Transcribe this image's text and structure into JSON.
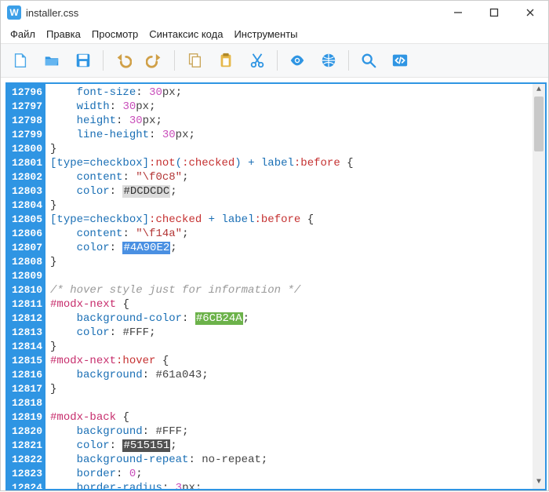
{
  "window": {
    "title": "installer.css",
    "app_initial": "W"
  },
  "menu": {
    "file": "Файл",
    "edit": "Правка",
    "view": "Просмотр",
    "syntax": "Синтаксис кода",
    "tools": "Инструменты"
  },
  "toolbar_icons": {
    "new": "new-file-icon",
    "open": "open-folder-icon",
    "save": "save-icon",
    "undo": "undo-icon",
    "redo": "redo-icon",
    "copy": "copy-icon",
    "paste": "paste-icon",
    "cut": "cut-icon",
    "eye": "eye-icon",
    "nav": "globe-icon",
    "find": "search-icon",
    "code": "code-icon"
  },
  "lines": [
    {
      "n": 12796,
      "indent": 2,
      "type": "prop",
      "prop": "font-size",
      "val": "30",
      "unit": "px"
    },
    {
      "n": 12797,
      "indent": 2,
      "type": "prop",
      "prop": "width",
      "val": "30",
      "unit": "px"
    },
    {
      "n": 12798,
      "indent": 2,
      "type": "prop",
      "prop": "height",
      "val": "30",
      "unit": "px"
    },
    {
      "n": 12799,
      "indent": 2,
      "type": "prop",
      "prop": "line-height",
      "val": "30",
      "unit": "px"
    },
    {
      "n": 12800,
      "indent": 0,
      "type": "close"
    },
    {
      "n": 12801,
      "indent": 0,
      "type": "raw",
      "html": "<span class='tk-sel'>[type=checkbox]</span><span class='tk-pseudo'>:not</span><span class='tk-sel'>(</span><span class='tk-pseudo'>:checked</span><span class='tk-sel'>) + label</span><span class='tk-pseudo'>:before</span> <span class='tk-brace'>{</span>"
    },
    {
      "n": 12802,
      "indent": 2,
      "type": "raw",
      "html": "<span class='tk-prop'>content</span><span class='tk-punct'>: </span><span class='tk-str'>\"\\f0c8\"</span><span class='tk-punct'>;</span>"
    },
    {
      "n": 12803,
      "indent": 2,
      "type": "raw",
      "html": "<span class='tk-prop'>color</span><span class='tk-punct'>: </span><span class='hl-grey'>#DCDCDC</span><span class='tk-punct'>;</span>"
    },
    {
      "n": 12804,
      "indent": 0,
      "type": "close"
    },
    {
      "n": 12805,
      "indent": 0,
      "type": "raw",
      "html": "<span class='tk-sel'>[type=checkbox]</span><span class='tk-pseudo'>:checked</span><span class='tk-sel'> + label</span><span class='tk-pseudo'>:before</span> <span class='tk-brace'>{</span>"
    },
    {
      "n": 12806,
      "indent": 2,
      "type": "raw",
      "html": "<span class='tk-prop'>content</span><span class='tk-punct'>: </span><span class='tk-str'>\"\\f14a\"</span><span class='tk-punct'>;</span>"
    },
    {
      "n": 12807,
      "indent": 2,
      "type": "raw",
      "html": "<span class='tk-prop'>color</span><span class='tk-punct'>: </span><span class='hl-blue'>#4A90E2</span><span class='tk-punct'>;</span>"
    },
    {
      "n": 12808,
      "indent": 0,
      "type": "close"
    },
    {
      "n": 12809,
      "indent": 0,
      "type": "blank"
    },
    {
      "n": 12810,
      "indent": 0,
      "type": "raw",
      "html": "<span class='tk-comment'>/* hover style just for information */</span>"
    },
    {
      "n": 12811,
      "indent": 0,
      "type": "raw",
      "html": "<span class='tk-id'>#modx-next</span> <span class='tk-brace'>{</span>"
    },
    {
      "n": 12812,
      "indent": 2,
      "type": "raw",
      "html": "<span class='tk-prop'>background-color</span><span class='tk-punct'>: </span><span class='hl-green'>#6CB24A</span><span class='tk-punct'>;</span>"
    },
    {
      "n": 12813,
      "indent": 2,
      "type": "raw",
      "html": "<span class='tk-prop'>color</span><span class='tk-punct'>: </span><span class='tk-val'>#FFF</span><span class='tk-punct'>;</span>"
    },
    {
      "n": 12814,
      "indent": 0,
      "type": "close"
    },
    {
      "n": 12815,
      "indent": 0,
      "type": "raw",
      "html": "<span class='tk-id'>#modx-next</span><span class='tk-pseudo'>:hover</span> <span class='tk-brace'>{</span>"
    },
    {
      "n": 12816,
      "indent": 2,
      "type": "raw",
      "html": "<span class='tk-prop'>background</span><span class='tk-punct'>: </span><span class='tk-val'>#61a043</span><span class='tk-punct'>;</span>"
    },
    {
      "n": 12817,
      "indent": 0,
      "type": "close"
    },
    {
      "n": 12818,
      "indent": 0,
      "type": "blank"
    },
    {
      "n": 12819,
      "indent": 0,
      "type": "raw",
      "html": "<span class='tk-id'>#modx-back</span> <span class='tk-brace'>{</span>"
    },
    {
      "n": 12820,
      "indent": 2,
      "type": "raw",
      "html": "<span class='tk-prop'>background</span><span class='tk-punct'>: </span><span class='tk-val'>#FFF</span><span class='tk-punct'>;</span>"
    },
    {
      "n": 12821,
      "indent": 2,
      "type": "raw",
      "html": "<span class='tk-prop'>color</span><span class='tk-punct'>: </span><span class='hl-dark'>#515151</span><span class='tk-punct'>;</span>"
    },
    {
      "n": 12822,
      "indent": 2,
      "type": "raw",
      "html": "<span class='tk-prop'>background-repeat</span><span class='tk-punct'>: </span><span class='tk-val'>no-repeat</span><span class='tk-punct'>;</span>"
    },
    {
      "n": 12823,
      "indent": 2,
      "type": "raw",
      "html": "<span class='tk-prop'>border</span><span class='tk-punct'>: </span><span class='tk-num'>0</span><span class='tk-punct'>;</span>"
    },
    {
      "n": 12824,
      "indent": 2,
      "type": "raw",
      "html": "<span class='tk-prop'>border-radius</span><span class='tk-punct'>: </span><span class='tk-num'>3</span><span class='tk-val'>px</span><span class='tk-punct'>;</span>"
    }
  ]
}
